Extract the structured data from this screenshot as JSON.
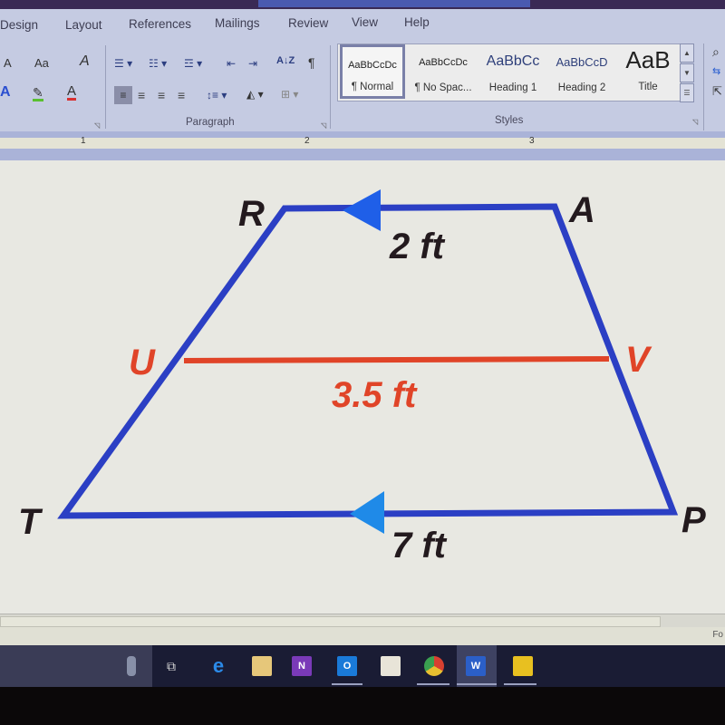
{
  "ribbon": {
    "tabs": [
      "Design",
      "Layout",
      "References",
      "Mailings",
      "Review",
      "View",
      "Help"
    ],
    "font_group": {
      "grow_font": "A",
      "change_case": "Aa",
      "text_effects": "A",
      "highlight": "✎",
      "font_color": "A"
    },
    "paragraph_group_label": "Paragraph",
    "styles_group_label": "Styles",
    "styles": [
      {
        "sample": "AaBbCcDc",
        "name": "¶ Normal",
        "selected": true
      },
      {
        "sample": "AaBbCcDc",
        "name": "¶ No Spac...",
        "selected": false
      },
      {
        "sample": "AaBbCc",
        "name": "Heading 1",
        "selected": false
      },
      {
        "sample": "AaBbCcD",
        "name": "Heading 2",
        "selected": false
      },
      {
        "sample": "AaB",
        "name": "Title",
        "selected": false
      }
    ],
    "pilcrow": "¶",
    "sort": "A↓Z"
  },
  "ruler": {
    "numbers": [
      "1",
      "2",
      "3"
    ]
  },
  "diagram": {
    "vertices": {
      "R": "R",
      "A": "A",
      "T": "T",
      "P": "P",
      "U": "U",
      "V": "V"
    },
    "top_base_label": "2 ft",
    "midsegment_label": "3.5 ft",
    "bottom_base_label": "7 ft",
    "colors": {
      "trapezoid": "#2b3fc4",
      "arrow": "#1f5fe8",
      "midsegment": "#e04428",
      "vertex_dark": "#231a1e",
      "midsegment_text": "#e04428"
    }
  },
  "status": {
    "focus": "Fo"
  },
  "taskbar": {
    "apps": [
      "microphone",
      "task-view",
      "edge",
      "file-explorer",
      "onenote",
      "outlook",
      "store",
      "chrome",
      "word",
      "sticky-notes"
    ]
  }
}
